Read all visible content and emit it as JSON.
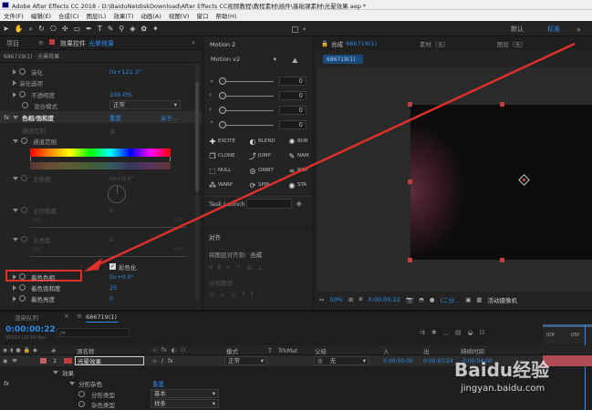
{
  "titlebar": {
    "title": "Adobe After Effects CC 2018 - D:\\BaiduNetdiskDownload\\After Effects CC视频教程\\教程素材\\插件\\基础课素材\\光晕效果.aep *"
  },
  "menubar": {
    "items": [
      "文件(F)",
      "编辑(E)",
      "合成(C)",
      "图层(L)",
      "效果(T)",
      "动画(A)",
      "视图(V)",
      "窗口",
      "帮助(H)"
    ]
  },
  "toolbar": {
    "workspaces": [
      "默认",
      "标准"
    ],
    "workspace_menu": "»"
  },
  "effects_panel": {
    "tab_project": "项目",
    "tab_title": "效果控件",
    "tab_layer": "光晕效果",
    "breadcrumb": "686719(1) · 光晕效果",
    "rows": {
      "evolution": {
        "label": "演化",
        "value": "0x+121.3°"
      },
      "evolution_options": {
        "label": "演化选项"
      },
      "opacity": {
        "label": "不透明度",
        "value": "100.0%"
      },
      "blend_mode": {
        "label": "混合模式",
        "value": "正常"
      },
      "effect_name": {
        "label": "色相/饱和度",
        "reset": "重置",
        "about": "关于..."
      },
      "channel_control": {
        "label": "通道控制",
        "value": "主"
      },
      "channel_range": {
        "label": "通道范围"
      },
      "master_hue": {
        "label": "主色相",
        "value": "0x+0.0°"
      },
      "master_sat": {
        "label": "主饱和度",
        "value": "0",
        "min": "-100",
        "max": "100"
      },
      "master_light": {
        "label": "主亮度",
        "value": "0",
        "min": "-100",
        "max": "100"
      },
      "colorize": {
        "label": "彩色化"
      },
      "colorize_hue": {
        "label": "着色色相",
        "value": "0x+0.0°"
      },
      "colorize_sat": {
        "label": "着色饱和度",
        "value": "25"
      },
      "colorize_light": {
        "label": "着色亮度",
        "value": "0"
      }
    }
  },
  "motion_panel": {
    "title": "Motion 2",
    "version": "Motion v2",
    "values": [
      "0",
      "0",
      "0",
      "0"
    ],
    "buttons": [
      "EXCITE",
      "BLEND",
      "BUR",
      "CLONE",
      "JUMP",
      "NAM",
      "NULL",
      "ORBIT",
      "ROP",
      "WARP",
      "SPIN",
      "STA"
    ],
    "task": "Task Launch",
    "task_button": "⊕"
  },
  "align_panel": {
    "title": "对齐",
    "align_to_label": "将图层对齐到:",
    "align_to_value": "合成",
    "distribute_label": "分布图层:"
  },
  "comp_panel": {
    "tab_title": "合成",
    "comp_name": "686719(1)",
    "breadcrumb": "686719(1)",
    "footage_tab": "素材（无）",
    "layer_tab": "图层（无）",
    "zoom": "50%",
    "timecode": "0:00:00:22",
    "quality": "(二分...",
    "camera": "活动摄像机"
  },
  "timeline": {
    "tab_render": "渲染队列",
    "tab_comp": "686719(1)",
    "timecode": "0:00:00:22",
    "frame_info": "00022 (25.00 fps)",
    "search_placeholder": "ρ▾",
    "ruler": [
      "00f",
      "05f"
    ],
    "columns": {
      "num": "#",
      "name": "源名称",
      "mode": "模式",
      "t": "T",
      "trkmat": "TrkMat",
      "parent": "父级",
      "in": "入",
      "out": "出",
      "duration": "持续时间"
    },
    "layer": {
      "num": "1",
      "name": "光晕效果",
      "mode": "正常",
      "parent": "无",
      "in": "0:00:00:00",
      "out": "0:00:03:24",
      "duration": "0:00:04:00"
    },
    "sub_rows": {
      "effects": "效果",
      "fractal": "分形杂色",
      "fractal_reset": "重置",
      "fractal_type_label": "分形类型",
      "fractal_type_value": "基本",
      "noise_type_label": "杂色类型",
      "noise_type_value": "样条"
    }
  },
  "watermark": {
    "brand": "Baidu经验",
    "url": "jingyan.baidu.com"
  }
}
